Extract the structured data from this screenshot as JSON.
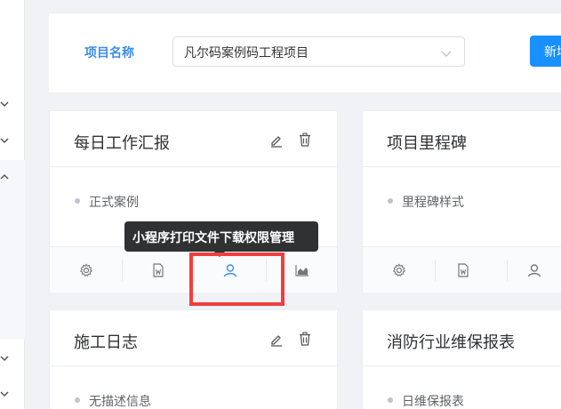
{
  "filter": {
    "label": "项目名称",
    "selected_project": "凡尔码案例码工程项目",
    "new_button_label": "新增"
  },
  "cards": [
    {
      "title": "每日工作汇报",
      "item": "正式案例"
    },
    {
      "title": "项目里程碑",
      "item": "里程碑样式"
    },
    {
      "title": "施工日志",
      "item": "无描述信息"
    },
    {
      "title": "消防行业维保报表",
      "item": "日维保报表"
    }
  ],
  "tooltip": {
    "text": "小程序打印文件下载权限管理"
  },
  "colors": {
    "accent": "#1890ff",
    "label_blue": "#3a8ee6",
    "highlight_red": "#f03e3e",
    "tooltip_bg": "#303133"
  }
}
